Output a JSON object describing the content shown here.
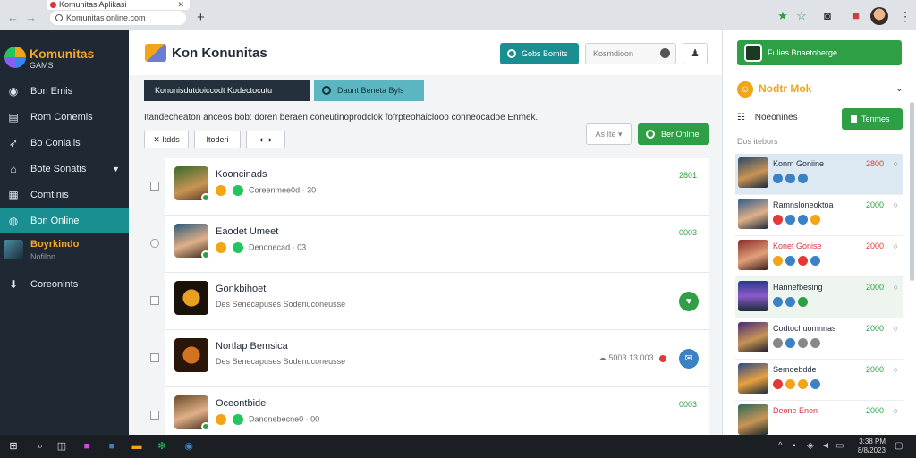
{
  "browser": {
    "tab_title": "Komunitas Aplikasi",
    "address": "Komunitas online.com",
    "new_tab": "+"
  },
  "sidebar": {
    "brand_name": "Komunitas",
    "brand_sub": "GAMS",
    "items": [
      {
        "label": "Bon Emis",
        "icon": "location-icon"
      },
      {
        "label": "Rom Conemis",
        "icon": "table-icon"
      },
      {
        "label": "Bo Conialis",
        "icon": "rocket-icon"
      },
      {
        "label": "Bote Sonatis",
        "icon": "home-icon"
      },
      {
        "label": "Comtinis",
        "icon": "grid-icon"
      },
      {
        "label": "Bon Online",
        "icon": "globe-icon"
      },
      {
        "label": "Coreonints",
        "icon": "download-icon"
      }
    ],
    "user": {
      "name": "Boyrkindo",
      "sub": "Nofilon"
    }
  },
  "header": {
    "title": "Kon Konunitas",
    "action_button": "Gobs Bomits",
    "search_value": "Kosmdioon",
    "icon_button": "user-icon"
  },
  "tabs": {
    "dark": "Konunisdutdoiccodt Kodectocutu",
    "teal": "Daunt Beneta Byls"
  },
  "description": "Itandecheaton anceos bob: doren beraen coneutinoprodclok fofrpteohaiclooo conneocadoe Enmek.",
  "filters": {
    "filter1": "Itdds",
    "filter2": "Itoderi"
  },
  "sort": {
    "label": "As Ite"
  },
  "online_button": "Ber Online",
  "list_rows": [
    {
      "name": "Kooncinads",
      "meta": "Coreenmee0d  ·  30",
      "value": "2801",
      "dots": "⋮"
    },
    {
      "name": "Eaodet Umeet",
      "meta": "Denonecad  ·  03",
      "value": "0003",
      "dots": "⋮"
    },
    {
      "name": "Gonkbihoet",
      "meta": "Des Senecapuses Sodenuconeusse",
      "value": ""
    },
    {
      "name": "Nortlap Bemsica",
      "meta": "Des Senecapuses Sodenuconeusse",
      "value": "",
      "status": "5003 13 003"
    },
    {
      "name": "Oceontbide",
      "meta": "Danonebecne0  ·  00",
      "value": "0003",
      "dots": "⋮"
    }
  ],
  "right_panel": {
    "top_button": "Fulies Bnaetoberge",
    "section_title": "Nodtr Mok",
    "sub_title": "Noeonines",
    "sub_button": "Tenmes",
    "label": "Dos itebors",
    "items": [
      {
        "name": "Konm Goniine",
        "value": "2800",
        "color": "#e53935"
      },
      {
        "name": "Ramnsloneoktoa",
        "value": "2000",
        "color": "#2e9f45"
      },
      {
        "name": "Konet Gonise",
        "value": "2000",
        "color": "#e53935"
      },
      {
        "name": "Hannefbesing",
        "value": "2000",
        "color": "#2e9f45"
      },
      {
        "name": "Codtochuomnnas",
        "value": "2000",
        "color": "#2e9f45"
      },
      {
        "name": "Semoebdde",
        "value": "2000",
        "color": "#2e9f45"
      },
      {
        "name": "Deone Enon",
        "value": "2000",
        "color": "#2e9f45"
      }
    ]
  },
  "taskbar": {
    "time": "3:38 PM",
    "date": "8/8/2023"
  },
  "colors": {
    "sidebar_bg": "#1f2933",
    "accent_teal": "#1a8f91",
    "accent_green": "#2e9f45",
    "brand_orange": "#f5a623"
  }
}
